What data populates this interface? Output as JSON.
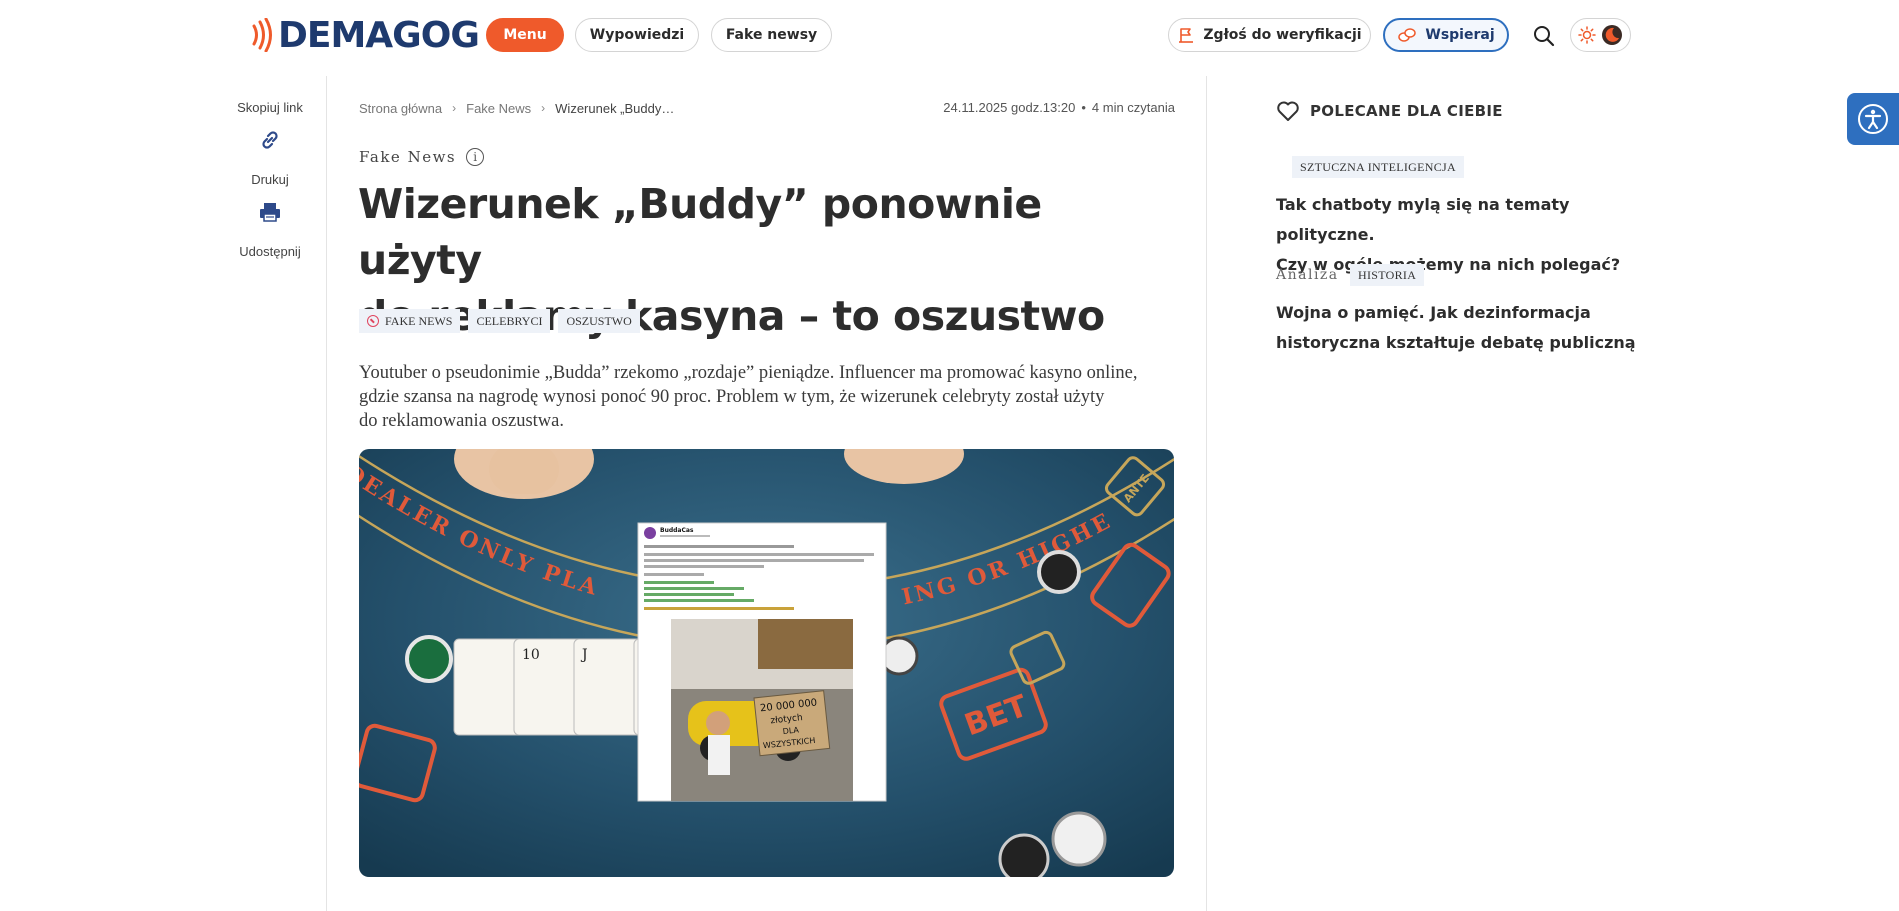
{
  "header": {
    "logo_text": "DEMAGOG",
    "nav": {
      "menu": "Menu",
      "wypowiedzi": "Wypowiedzi",
      "fake_newsy": "Fake newsy"
    },
    "report_button": "Zgłoś do weryfikacji",
    "support_button": "Wspieraj",
    "icons": {
      "search": "search-icon",
      "light_mode": "sun-icon",
      "dark_mode": "moon-icon"
    }
  },
  "colors": {
    "brand_orange": "#ef5a2b",
    "brand_navy": "#1e3a6e",
    "accent_blue": "#2e6fbf",
    "tag_bg": "#eef2f8"
  },
  "tools": {
    "copy_link": "Skopiuj link",
    "print": "Drukuj",
    "share": "Udostępnij"
  },
  "breadcrumb": {
    "home": "Strona główna",
    "section": "Fake News",
    "current": "Wizerunek „Buddy…"
  },
  "meta": {
    "date": "24.11.2025 godz.13:20",
    "read_time": "4 min czytania"
  },
  "article": {
    "section": "Fake News",
    "title_line1": "Wizerunek „Buddy” ponownie użyty",
    "title_line2": "do reklamy kasyna – to oszustwo",
    "tags": [
      "FAKE NEWS",
      "CELEBRYCI",
      "OSZUSTWO"
    ],
    "lead_line1": "Youtuber o pseudonimie „Budda” rzekomo „rozdaje” pieniądze. Influencer ma promować kasyno online,",
    "lead_line2": "gdzie szansa na nagrodę wynosi ponoć 90 proc. Problem w tym, że wizerunek celebryty został użyty",
    "lead_line3": "do reklamowania oszustwa.",
    "image": {
      "table_text_1": "DEALER ONLY PLA",
      "table_text_2": "ING OR HIGHE",
      "bet": "BET",
      "ante": "ANTE",
      "post_author": "BuddaCas",
      "sign_line1": "20 000 000",
      "sign_line2": "złotych",
      "sign_line3": "DLA",
      "sign_line4": "WSZYSTKICH"
    }
  },
  "recommended": {
    "heading": "POLECANE DLA CIEBIE",
    "items": [
      {
        "type": "",
        "tag": "SZTUCZNA INTELIGENCJA",
        "title_line1": "Tak chatboty mylą się na tematy polityczne.",
        "title_line2": "Czy w ogóle możemy na nich polegać?"
      },
      {
        "type": "Analiza",
        "tag": "HISTORIA",
        "title_line1": "Wojna o pamięć. Jak dezinformacja",
        "title_line2": "historyczna kształtuje debatę publiczną"
      }
    ]
  }
}
